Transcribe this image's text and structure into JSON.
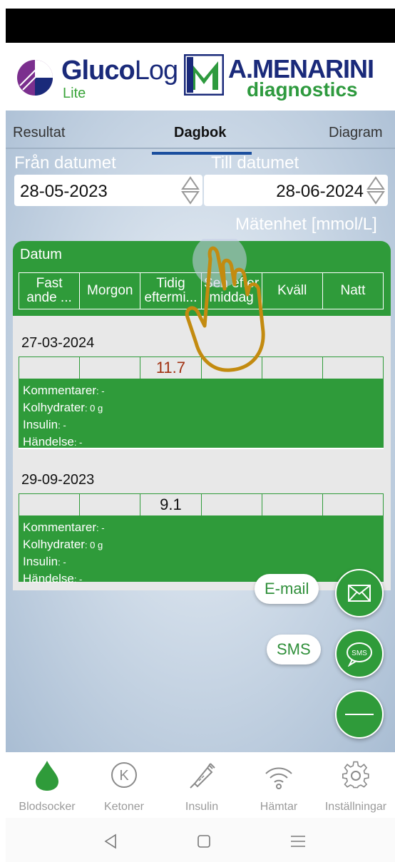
{
  "header": {
    "app_name_bold": "Gluco",
    "app_name_light": "Log",
    "app_edition": "Lite",
    "partner_name": "A.MENARINI",
    "partner_sub": "diagnostics",
    "brand_color": "#1a2a7a",
    "accent_green": "#2f9b3a"
  },
  "tabs": [
    {
      "label": "Resultat"
    },
    {
      "label": "Dagbok"
    },
    {
      "label": "Diagram"
    }
  ],
  "filters": {
    "from_label": "Från datumet",
    "from_value": "28-05-2023",
    "to_label": "Till datumet",
    "to_value": "28-06-2024",
    "unit_label": "Mätenhet [mmol/L]"
  },
  "table": {
    "title": "Datum",
    "columns": [
      "Fast ande ...",
      "Morgon",
      "Tidig eftermi...",
      "Sen efter middag",
      "Kväll",
      "Natt"
    ],
    "entries": [
      {
        "date": "27-03-2024",
        "values": [
          "",
          "",
          "11.7",
          "",
          "",
          ""
        ],
        "kommentarer_label": "Kommentarer",
        "kommentarer_value": ": -",
        "kolhydrater_label": "Kolhydrater",
        "kolhydrater_value": ": 0 g",
        "insulin_label": "Insulin",
        "insulin_value": ": -",
        "handelse_label": "Händelse",
        "handelse_value": ": -"
      },
      {
        "date": "29-09-2023",
        "values": [
          "",
          "",
          "9.1",
          "",
          "",
          ""
        ],
        "kommentarer_label": "Kommentarer",
        "kommentarer_value": ": -",
        "kolhydrater_label": "Kolhydrater",
        "kolhydrater_value": ": 0 g",
        "insulin_label": "Insulin",
        "insulin_value": ": -",
        "handelse_label": "Händelse",
        "handelse_value": ": -"
      }
    ]
  },
  "fab": {
    "email_label": "E-mail",
    "sms_label": "SMS",
    "sms_icon_text": "SMS"
  },
  "bottom_nav": [
    {
      "label": "Blodsocker",
      "icon": "drop-icon"
    },
    {
      "label": "Ketoner",
      "icon": "ketone-k-icon"
    },
    {
      "label": "Insulin",
      "icon": "syringe-icon"
    },
    {
      "label": "Hämtar",
      "icon": "wifi-icon"
    },
    {
      "label": "Inställningar",
      "icon": "gear-icon"
    }
  ],
  "ketone_letter": "K"
}
